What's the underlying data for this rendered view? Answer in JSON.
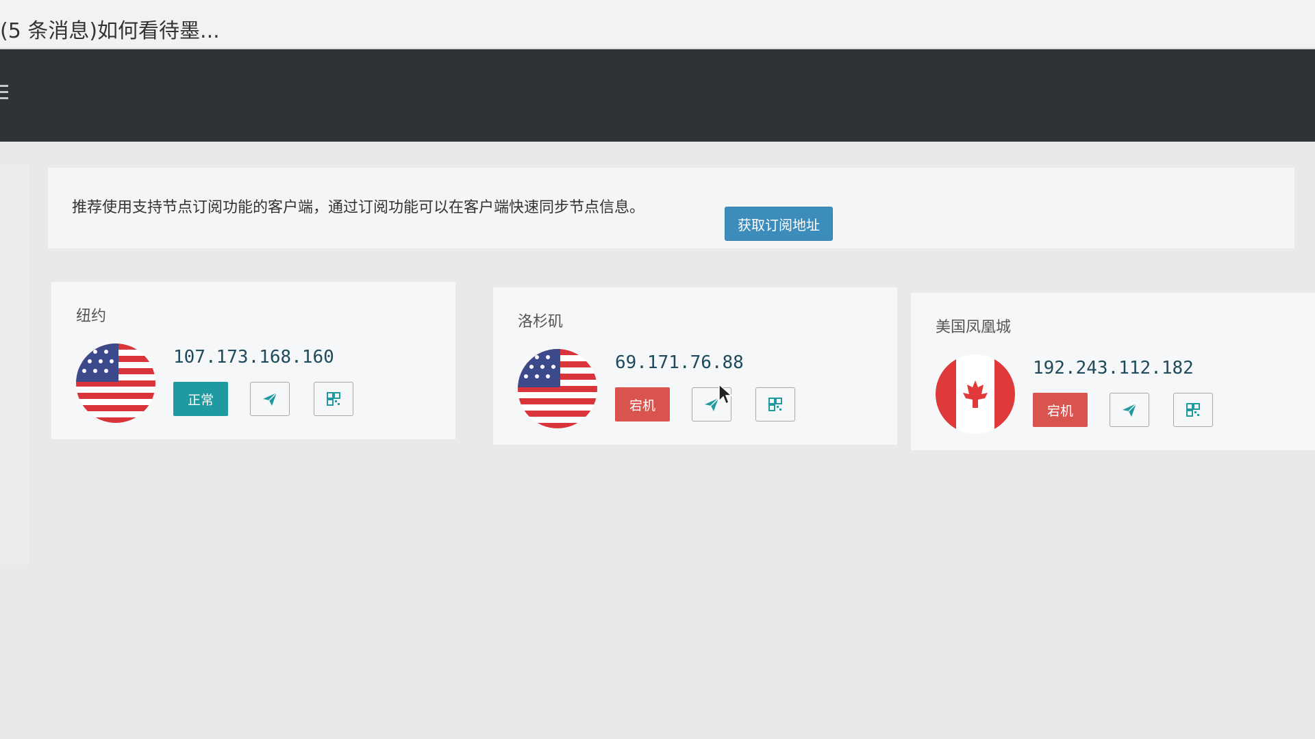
{
  "tab": {
    "title": "(5 条消息)如何看待墨..."
  },
  "notice": {
    "text": "推荐使用支持节点订阅功能的客户端，通过订阅功能可以在客户端快速同步节点信息。",
    "button_label": "获取订阅地址"
  },
  "nodes": [
    {
      "name": "纽约",
      "ip": "107.173.168.160",
      "status": "正常",
      "flag": "us-flag-icon"
    },
    {
      "name": "洛杉矶",
      "ip": "69.171.76.88",
      "status": "宕机",
      "flag": "us-flag-icon"
    },
    {
      "name": "美国凤凰城",
      "ip": "192.243.112.182",
      "status": "宕机",
      "flag": "ca-flag-icon"
    }
  ],
  "colors": {
    "navbar": "#2f3337",
    "primary_button": "#3c8dbc",
    "status_normal": "#1f9aa0",
    "status_down": "#d9534f"
  }
}
